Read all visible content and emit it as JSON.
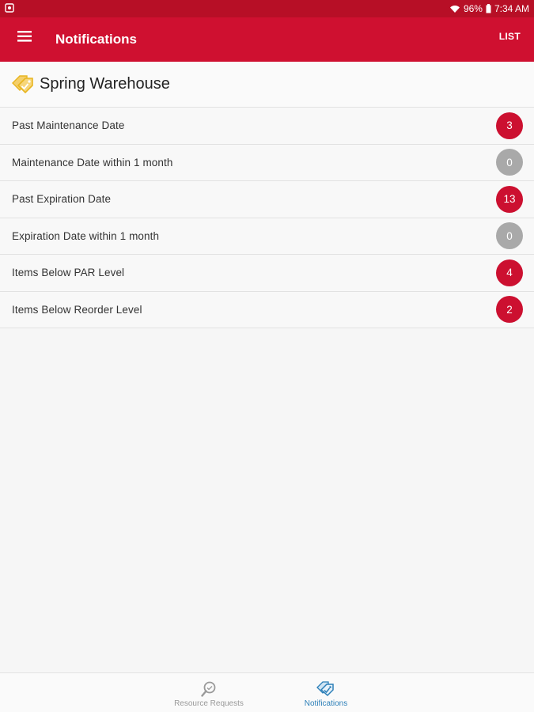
{
  "status_bar": {
    "battery": "96%",
    "time": "7:34 AM"
  },
  "app_bar": {
    "title": "Notifications",
    "action_label": "LIST"
  },
  "warehouse": {
    "name": "Spring Warehouse"
  },
  "notifications": [
    {
      "label": "Past Maintenance Date",
      "count": "3",
      "color": "#cc1030"
    },
    {
      "label": "Maintenance Date within 1 month",
      "count": "0",
      "color": "#a9a9a9"
    },
    {
      "label": "Past Expiration Date",
      "count": "13",
      "color": "#cc1030"
    },
    {
      "label": "Expiration Date within 1 month",
      "count": "0",
      "color": "#a9a9a9"
    },
    {
      "label": "Items Below PAR Level",
      "count": "4",
      "color": "#cc1030"
    },
    {
      "label": "Items Below Reorder Level",
      "count": "2",
      "color": "#cc1030"
    }
  ],
  "bottom_nav": {
    "items": [
      {
        "label": "Resource Requests",
        "icon": "magnifier-icon",
        "active": false
      },
      {
        "label": "Notifications",
        "icon": "tag-icon",
        "active": true
      }
    ]
  },
  "colors": {
    "brand": "#cf1030",
    "status_bar": "#b70f26",
    "active_tab": "#2c7fb8",
    "warehouse_icon": "#e8b520"
  }
}
